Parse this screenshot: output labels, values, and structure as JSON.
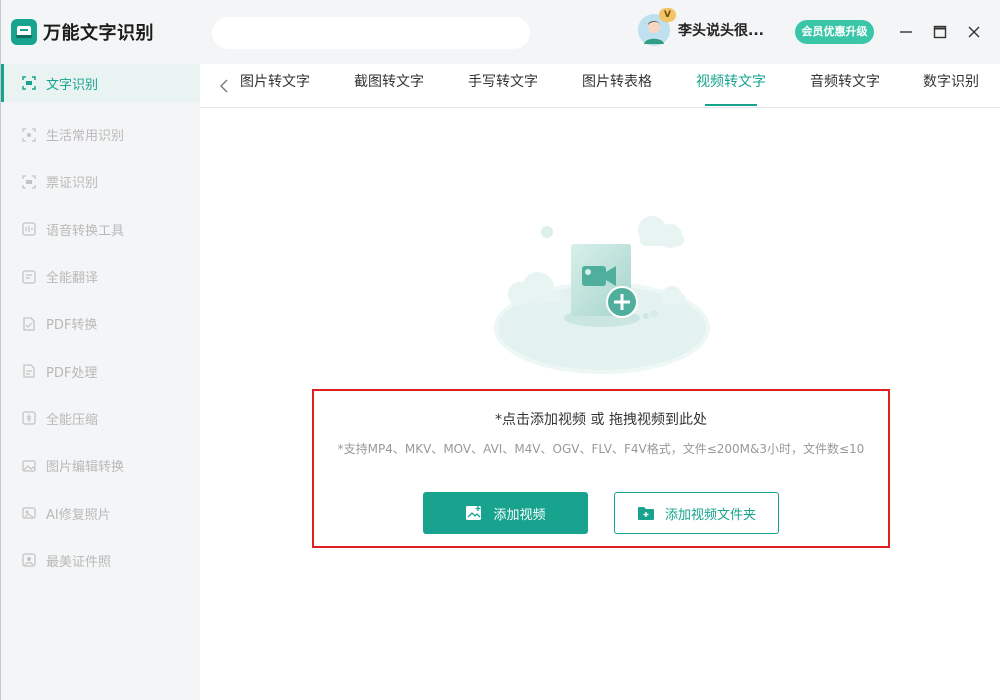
{
  "app": {
    "title": "万能文字识别",
    "accent": "#17a38e"
  },
  "sidebar": {
    "items": [
      {
        "label": "文字识别",
        "icon": "scan-text-icon",
        "active": true
      },
      {
        "label": "生活常用识别",
        "icon": "scan-frame-icon"
      },
      {
        "label": "票证识别",
        "icon": "scan-frame-icon"
      },
      {
        "label": "语音转换工具",
        "icon": "audio-convert-icon"
      },
      {
        "label": "全能翻译",
        "icon": "translate-icon"
      },
      {
        "label": "PDF转换",
        "icon": "pdf-convert-icon"
      },
      {
        "label": "PDF处理",
        "icon": "pdf-process-icon"
      },
      {
        "label": "全能压缩",
        "icon": "compress-icon"
      },
      {
        "label": "图片编辑转换",
        "icon": "image-edit-icon"
      },
      {
        "label": "AI修复照片",
        "icon": "photo-repair-icon"
      },
      {
        "label": "最美证件照",
        "icon": "id-photo-icon"
      }
    ]
  },
  "header": {
    "user_name": "李头说头很...",
    "vip_badge": "V",
    "upgrade_label": "会员优惠升级"
  },
  "tabs": [
    {
      "label": "图片转文字"
    },
    {
      "label": "截图转文字"
    },
    {
      "label": "手写转文字"
    },
    {
      "label": "图片转表格"
    },
    {
      "label": "视频转文字",
      "active": true
    },
    {
      "label": "音频转文字"
    },
    {
      "label": "数字识别"
    }
  ],
  "dropzone": {
    "title": "*点击添加视频 或 拖拽视频到此处",
    "subtitle": "*支持MP4、MKV、MOV、AVI、M4V、OGV、FLV、F4V格式，文件≤200M&3小时，文件数≤10",
    "add_video_label": "添加视频",
    "add_folder_label": "添加视频文件夹",
    "highlight_color": "#e02020"
  }
}
